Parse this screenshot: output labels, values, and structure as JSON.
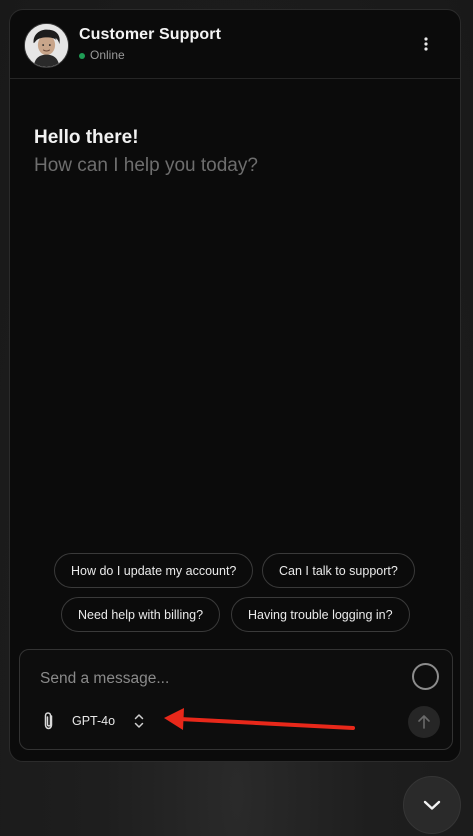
{
  "header": {
    "agent_name": "Customer Support",
    "status": "Online",
    "status_color": "#1f9d55",
    "menu_icon": "more-vertical-icon",
    "avatar_icon": "user-avatar-icon"
  },
  "greeting": {
    "title": "Hello there!",
    "subtitle": "How can I help you today?"
  },
  "suggestions": [
    {
      "label": "How do I update my account?"
    },
    {
      "label": "Can I talk to support?"
    },
    {
      "label": "Need help with billing?"
    },
    {
      "label": "Having trouble logging in?"
    }
  ],
  "composer": {
    "placeholder": "Send a message...",
    "model": "GPT-4o",
    "attach_icon": "paperclip-icon",
    "model_toggle_icon": "chevrons-up-down-icon",
    "send_icon": "arrow-up-icon",
    "status_icon": "spinner-icon"
  },
  "annotation": {
    "color": "#e8281a",
    "icon": "arrow-left-annotation"
  },
  "scroll_button": {
    "icon": "chevron-down-icon"
  }
}
